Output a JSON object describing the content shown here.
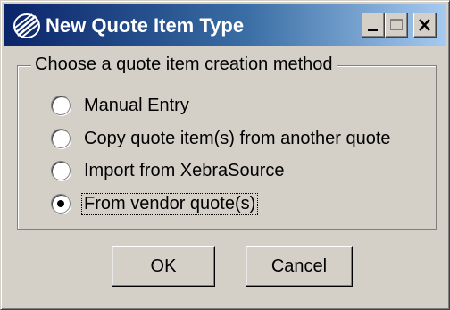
{
  "window": {
    "title": "New Quote Item Type",
    "icon": "xebra-logo-icon",
    "title_bar_colors": [
      "#0a246a",
      "#a6caf0"
    ]
  },
  "group": {
    "legend": "Choose a quote item creation method",
    "options": [
      {
        "label": "Manual Entry",
        "selected": false
      },
      {
        "label": "Copy quote item(s) from another quote",
        "selected": false
      },
      {
        "label": "Import from XebraSource",
        "selected": false
      },
      {
        "label": "From vendor quote(s)",
        "selected": true
      }
    ]
  },
  "buttons": {
    "ok": "OK",
    "cancel": "Cancel"
  }
}
